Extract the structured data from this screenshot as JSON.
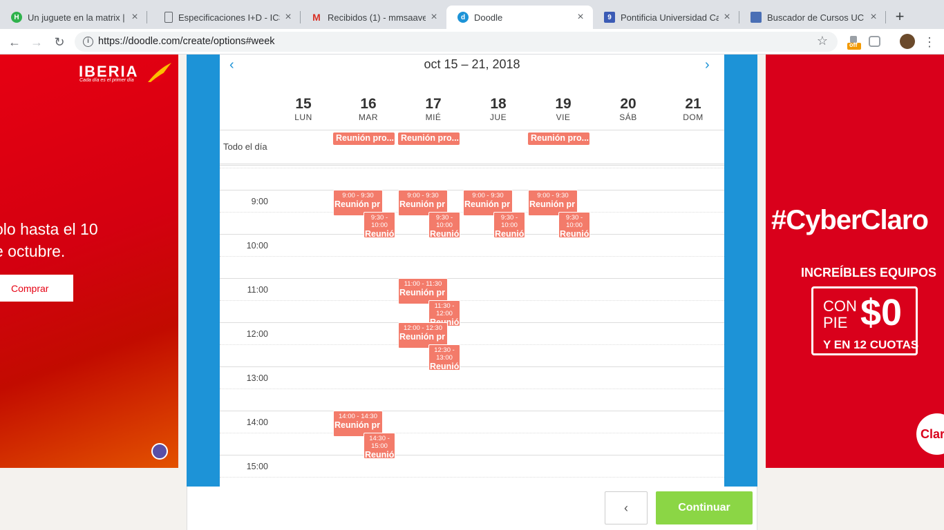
{
  "browser": {
    "tabs": [
      {
        "title": "Un juguete en la matrix | L",
        "favicon": "H",
        "favicon_color": "#2fb24c"
      },
      {
        "title": "Especificaciones I+D - ICS",
        "favicon": "doc",
        "favicon_color": "#5f6368"
      },
      {
        "title": "Recibidos (1) - mmsaaved",
        "favicon": "M",
        "favicon_color": "#d93025"
      },
      {
        "title": "Doodle",
        "favicon": "d",
        "favicon_color": "#1d93d7",
        "active": true
      },
      {
        "title": "Pontificia Universidad Cat",
        "favicon": "9",
        "favicon_color": "#3b5bb5"
      },
      {
        "title": "Buscador de Cursos UC -",
        "favicon": "book",
        "favicon_color": "#4a6fb5"
      }
    ],
    "url": "https://doodle.com/create/options#week",
    "extension_badge": "off"
  },
  "ads": {
    "left": {
      "brand": "IBERIA",
      "tagline": "Cada día es el primer día",
      "promo_line1": "olo hasta el 10",
      "promo_line2": "e octubre.",
      "button": "Comprar"
    },
    "right": {
      "headline": "#CyberClaro",
      "subline": "INCREÍBLES EQUIPOS",
      "con_pie": "CON PIE",
      "price": "$0",
      "cuotas": "Y EN 12 CUOTAS",
      "brand_fragment": "Clar"
    }
  },
  "calendar": {
    "week_title": "oct 15 – 21, 2018",
    "days": [
      {
        "num": "15",
        "name": "LUN"
      },
      {
        "num": "16",
        "name": "MAR"
      },
      {
        "num": "17",
        "name": "MIÉ"
      },
      {
        "num": "18",
        "name": "JUE"
      },
      {
        "num": "19",
        "name": "VIE"
      },
      {
        "num": "20",
        "name": "SÁB"
      },
      {
        "num": "21",
        "name": "DOM"
      }
    ],
    "all_day_label": "Todo el día",
    "all_day_events": [
      {
        "day": 1,
        "label": "Reunión pro..."
      },
      {
        "day": 2,
        "label": "Reunión pro..."
      },
      {
        "day": 4,
        "label": "Reunión pro..."
      }
    ],
    "hours": [
      "9:00",
      "10:00",
      "11:00",
      "12:00",
      "13:00",
      "14:00",
      "15:00"
    ],
    "events": [
      {
        "day": 1,
        "start": 9.0,
        "end": 9.5,
        "time": "9:00 - 9:30",
        "label": "Reunión pr"
      },
      {
        "day": 1,
        "start": 9.5,
        "end": 10.0,
        "time": "9:30 - 10:00",
        "label": "Reunió",
        "half": true
      },
      {
        "day": 2,
        "start": 9.0,
        "end": 9.5,
        "time": "9:00 - 9:30",
        "label": "Reunión pr"
      },
      {
        "day": 2,
        "start": 9.5,
        "end": 10.0,
        "time": "9:30 - 10:00",
        "label": "Reunió",
        "half": true
      },
      {
        "day": 3,
        "start": 9.0,
        "end": 9.5,
        "time": "9:00 - 9:30",
        "label": "Reunión pr"
      },
      {
        "day": 3,
        "start": 9.5,
        "end": 10.0,
        "time": "9:30 - 10:00",
        "label": "Reunió",
        "half": true
      },
      {
        "day": 4,
        "start": 9.0,
        "end": 9.5,
        "time": "9:00 - 9:30",
        "label": "Reunión pr"
      },
      {
        "day": 4,
        "start": 9.5,
        "end": 10.0,
        "time": "9:30 - 10:00",
        "label": "Reunió",
        "half": true
      },
      {
        "day": 2,
        "start": 11.0,
        "end": 11.5,
        "time": "11:00 - 11:30",
        "label": "Reunión pr"
      },
      {
        "day": 2,
        "start": 11.5,
        "end": 12.0,
        "time": "11:30 - 12:00",
        "label": "Reunió",
        "half": true
      },
      {
        "day": 2,
        "start": 12.0,
        "end": 12.5,
        "time": "12:00 - 12:30",
        "label": "Reunión pr"
      },
      {
        "day": 2,
        "start": 12.5,
        "end": 13.0,
        "time": "12:30 - 13:00",
        "label": "Reunió",
        "half": true
      },
      {
        "day": 1,
        "start": 14.0,
        "end": 14.5,
        "time": "14:00 - 14:30",
        "label": "Reunión pr"
      },
      {
        "day": 1,
        "start": 14.5,
        "end": 15.0,
        "time": "14:30 - 15:00",
        "label": "Reunió",
        "half": true
      }
    ]
  },
  "footer": {
    "back_label": "‹",
    "continue_label": "Continuar"
  },
  "colors": {
    "doodle_blue": "#1d93d7",
    "event": "#f37b6a",
    "continue": "#8bd645"
  }
}
